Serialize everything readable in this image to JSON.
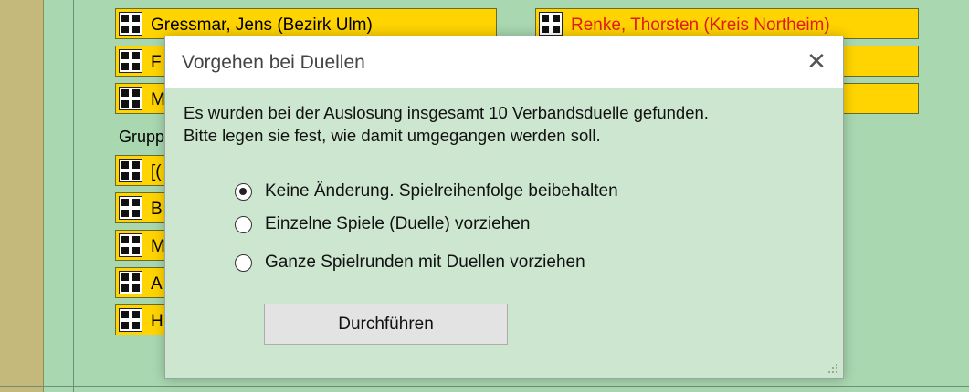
{
  "background_players_left": [
    {
      "name": "Gressmar, Jens (Bezirk Ulm)",
      "color": "#000000"
    },
    {
      "name": "F",
      "color": "#000000"
    },
    {
      "name": "M",
      "color": "#000000"
    }
  ],
  "background_players_right": [
    {
      "name": "Renke, Thorsten (Kreis Northeim)",
      "color": "#e11b1b"
    },
    {
      "name": "",
      "color": "#000000"
    },
    {
      "name": "",
      "color": "#000000"
    }
  ],
  "group_label": "Grupp",
  "group_players": [
    {
      "name": "[("
    },
    {
      "name": "B"
    },
    {
      "name": "M"
    },
    {
      "name": "A"
    },
    {
      "name": "H"
    }
  ],
  "dialog": {
    "title": "Vorgehen bei Duellen",
    "close_glyph": "✕",
    "message_line1": "Es wurden bei der Auslosung insgesamt 10 Verbandsduelle gefunden.",
    "message_line2": "Bitte legen sie fest, wie damit umgegangen werden soll.",
    "options": [
      {
        "label": "Keine Änderung. Spielreihenfolge beibehalten",
        "checked": true
      },
      {
        "label": "Einzelne Spiele (Duelle) vorziehen",
        "checked": false
      },
      {
        "label": "Ganze Spielrunden mit Duellen vorziehen",
        "checked": false
      }
    ],
    "button_label": "Durchführen"
  },
  "colors": {
    "background": "#a8d7b0",
    "dialog_body": "#cde6cf",
    "player_box": "#ffd400",
    "highlight_name": "#e11b1b"
  },
  "icons": [
    "chess-board-icon",
    "close-icon",
    "radio-selected-icon",
    "resize-grip-icon"
  ]
}
